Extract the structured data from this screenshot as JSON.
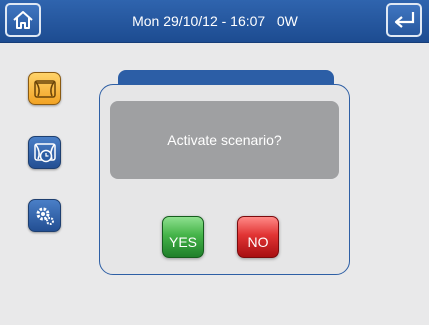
{
  "header": {
    "status_text": "Mon 29/10/12 - 16:07   0W",
    "home_icon": "home-icon",
    "back_icon": "return-arrow-icon"
  },
  "sidebar": {
    "items": [
      {
        "name": "scenario",
        "icon": "scenario-icon",
        "state": "active"
      },
      {
        "name": "timed-scenario",
        "icon": "timed-scenario-icon"
      },
      {
        "name": "settings",
        "icon": "gear-icon"
      }
    ]
  },
  "dialog": {
    "message": "Activate scenario?",
    "yes_label": "YES",
    "no_label": "NO"
  },
  "colors": {
    "header": "#2a5ca3",
    "background": "#e9e9ea",
    "dialog_border": "#2e5fa5",
    "message_box": "#9fa0a2",
    "yes": "#45b449",
    "no": "#e13434",
    "active_item": "#f2a324"
  }
}
